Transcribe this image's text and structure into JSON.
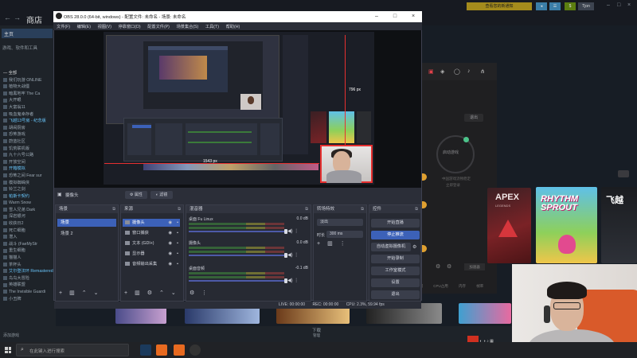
{
  "steam": {
    "title": "商店",
    "home_label": "主页",
    "filter_label": "游戏、软件和工具",
    "add_game": "添加游戏",
    "downloads": "下载",
    "downloads_sub": "管理",
    "notice_btn": "查看您的新通知",
    "user_btn": "Tjon",
    "library": [
      {
        "label": "— 全部",
        "type": "hdr"
      },
      {
        "label": "我们玩游 ONLINE",
        "type": ""
      },
      {
        "label": "植物大战僵",
        "type": ""
      },
      {
        "label": "暗黑地牢 The Ca",
        "type": ""
      },
      {
        "label": "大开眼",
        "type": ""
      },
      {
        "label": "大富翁11",
        "type": ""
      },
      {
        "label": "吸血鬼幸存者",
        "type": ""
      },
      {
        "label": "飞越13号房 - 纪念版",
        "type": "hi"
      },
      {
        "label": "胡闹厨房",
        "type": ""
      },
      {
        "label": "恐怖游戏",
        "type": ""
      },
      {
        "label": "蔚蓝社区",
        "type": ""
      },
      {
        "label": "饥荒联机版",
        "type": ""
      },
      {
        "label": "九十六号公路",
        "type": ""
      },
      {
        "label": "开放空间",
        "type": ""
      },
      {
        "label": "开箱模拟",
        "type": "hi"
      },
      {
        "label": "恐怖之间 Fear sur",
        "type": ""
      },
      {
        "label": "模拟蜘蛛侠",
        "type": ""
      },
      {
        "label": "铃兰之剑",
        "type": ""
      },
      {
        "label": "帕斯卡契约",
        "type": "hi"
      },
      {
        "label": "Warm Snow",
        "type": ""
      },
      {
        "label": "雪人兄弟 Dark",
        "type": ""
      },
      {
        "label": "深岩银河",
        "type": ""
      },
      {
        "label": "收获日2",
        "type": ""
      },
      {
        "label": "死亡细胞",
        "type": ""
      },
      {
        "label": "潜入",
        "type": ""
      },
      {
        "label": "战斗 (FaeMyStr",
        "type": ""
      },
      {
        "label": "重生细胞",
        "type": ""
      },
      {
        "label": "猫猫人",
        "type": ""
      },
      {
        "label": "茶杯头",
        "type": ""
      },
      {
        "label": "艾尔登法环 Remastered",
        "type": "hi"
      },
      {
        "label": "鸟鸟大冒险",
        "type": ""
      },
      {
        "label": "英雄联盟",
        "type": ""
      },
      {
        "label": "The Invisible Guardi",
        "type": ""
      },
      {
        "label": "小丑牌",
        "type": ""
      }
    ]
  },
  "store": {
    "status_btn": "退出",
    "circle_label": "启动游戏",
    "sub1": "中国游戏流畅稳定",
    "sub2": "立即登录",
    "status2": "加速器",
    "tags": [
      "热门",
      "CPU占用",
      "内存",
      "帧率"
    ],
    "tiles": {
      "apex_title": "APEX",
      "apex_sub": "LEGENDS",
      "rhythm_title": "RHYTHM SPROUT",
      "feixi_title": "飞越"
    }
  },
  "obs": {
    "title": "OBS 28.0.0 (64-bit, windows) - 配置文件: 未命名 - 场景: 未命名",
    "menu": [
      "文件(F)",
      "编辑(E)",
      "视图(V)",
      "停靠窗口(D)",
      "配置文件(P)",
      "场景集合(S)",
      "工具(T)",
      "帮助(H)"
    ],
    "preview_dim_v": "796 px",
    "preview_dim_h": "1543 px",
    "source_name": "摄像头",
    "props_btn": "属性",
    "filters_btn": "滤镜",
    "scenes_title": "场景",
    "scenes": [
      "场景",
      "场景 2"
    ],
    "sources_title": "来源",
    "sources": [
      "摄像头",
      "窗口捕获",
      "文本 (GDI+)",
      "显示器",
      "音频输出采集"
    ],
    "mixer_title": "混音器",
    "mixer": [
      {
        "name": "桌面 Fu Linux",
        "db": "0.0 dB"
      },
      {
        "name": "摄像头",
        "db": "0.0 dB"
      },
      {
        "name": "桌面音频",
        "db": "-0.1 dB"
      }
    ],
    "mixer_ticks": "-60 -55 -50 -45 -40 -35 -30 -25 -20 -15 -10 -5 0",
    "transitions_title": "转场特效",
    "transition_type": "淡出",
    "duration_label": "时长",
    "duration_value": "300 ms",
    "controls_title": "控件",
    "controls": [
      "开始直播",
      "停止推流",
      "自动虚拟摄像机",
      "开始录制",
      "工作室模式",
      "设置",
      "退出"
    ],
    "status": [
      "LIVE: 00:00:00",
      "REC: 00:00:00",
      "CPU: 2.3%, 59.94 fps"
    ]
  },
  "taskbar": {
    "search_placeholder": "在此键入进行搜索"
  },
  "colors": {
    "obs_accent": "#3c61b8",
    "red_guides": "#e63030",
    "steam_bg": "#171d25"
  }
}
